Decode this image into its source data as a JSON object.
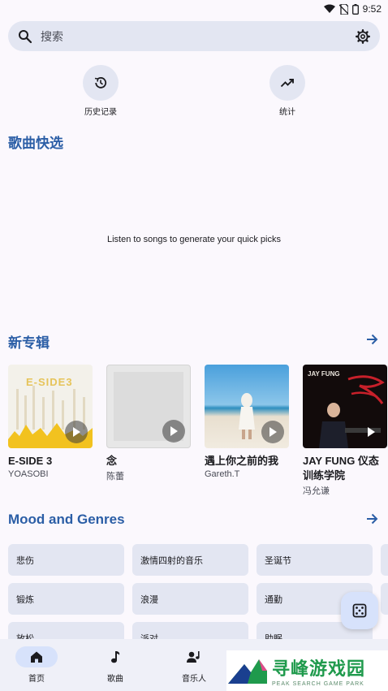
{
  "status_bar": {
    "time": "9:52"
  },
  "search": {
    "placeholder": "搜索"
  },
  "quick_actions": [
    {
      "label": "历史记录",
      "icon": "history-icon"
    },
    {
      "label": "统计",
      "icon": "trending-up-icon"
    }
  ],
  "quick_picks": {
    "title": "歌曲快选",
    "empty_message": "Listen to songs to generate your quick picks"
  },
  "new_albums": {
    "title": "新专辑",
    "albums": [
      {
        "title": "E-SIDE 3",
        "artist": "YOASOBI",
        "cover_text": "E-SIDE3"
      },
      {
        "title": "念",
        "artist": "陈蕾"
      },
      {
        "title": "遇上你之前的我",
        "artist": "Gareth.T"
      },
      {
        "title": "JAY FUNG 仪态训练学院",
        "artist": "冯允谦",
        "cover_text": "JAY FUNG"
      }
    ]
  },
  "mood_genres": {
    "title": "Mood and Genres",
    "chips": [
      "悲伤",
      "激情四射的音乐",
      "圣诞节",
      "锻炼",
      "浪漫",
      "通勤",
      "放松",
      "派对",
      "助眠"
    ]
  },
  "nav": {
    "items": [
      {
        "label": "首页",
        "icon": "home-icon",
        "active": true
      },
      {
        "label": "歌曲",
        "icon": "music-note-icon",
        "active": false
      },
      {
        "label": "音乐人",
        "icon": "artist-icon",
        "active": false
      }
    ]
  },
  "watermark": {
    "text_cn": "寻峰游戏园",
    "text_en": "PEAK SEARCH GAME PARK"
  },
  "colors": {
    "accent": "#2b5ea6",
    "surface": "#e3e6f2",
    "background": "#fbf8fd"
  }
}
